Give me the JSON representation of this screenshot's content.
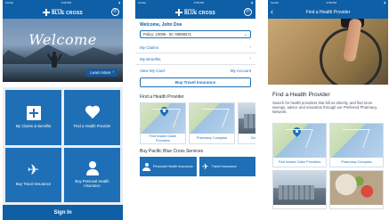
{
  "status": {
    "carrier": "Carrier",
    "time": "2:56 PM"
  },
  "brand": {
    "top": "PACIFIC",
    "name": "BLUE CROSS"
  },
  "screen1": {
    "hero_title": "Welcome",
    "learn_more": "Learn More",
    "tiles": [
      {
        "label": "My Claims & Benefits",
        "icon": "claims-plus-icon"
      },
      {
        "label": "Find a Health Provider",
        "icon": "heart-icon"
      },
      {
        "label": "Buy Travel Insurance",
        "icon": "plane-icon"
      },
      {
        "label": "Buy Personal Health Insurance",
        "icon": "person-icon"
      }
    ],
    "sign_in": "Sign In"
  },
  "screen2": {
    "welcome": "Welcome, John Doe",
    "policy": "Policy: 10099 - ID: 00999371",
    "menu": [
      "My Claims",
      "My Benefits"
    ],
    "view_card": "View My Card",
    "my_account": "My Account",
    "buy_travel": "Buy Travel Insurance",
    "find_provider_heading": "Find a Health Provider",
    "provider_cards": [
      "Find Instant Claim Providers",
      "Pharmacy Compass",
      "Buy My Ph..."
    ],
    "services_heading": "Buy Pacific Blue Cross Services",
    "services": [
      "Personal Health Insurance",
      "Travel Insurance"
    ]
  },
  "screen3": {
    "title": "Find a Health Provider",
    "heading": "Find a Health Provider",
    "description": "Search for health providers that bill us directly, and find more savings, advice and education through our Preferred Pharmacy Network.",
    "cards": [
      "Find Instant Claim Providers",
      "Pharmacy Compass"
    ]
  }
}
